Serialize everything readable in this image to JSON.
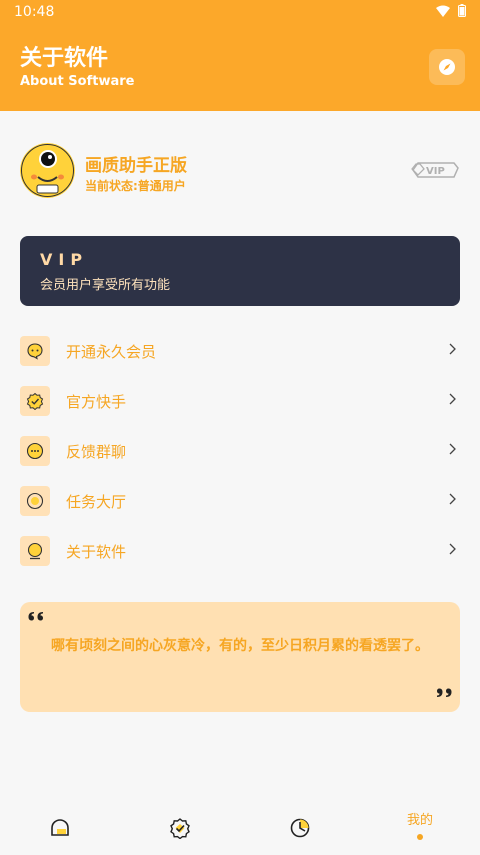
{
  "status_bar": {
    "time": "10:48"
  },
  "header": {
    "title": "关于软件",
    "subtitle": "About Software",
    "compass_icon": "compass-icon"
  },
  "profile": {
    "app_name": "画质助手正版",
    "status": "当前状态:普通用户",
    "badge": "VIP"
  },
  "vip_card": {
    "title": "VIP",
    "description": "会员用户享受所有功能"
  },
  "menu": [
    {
      "label": "开通永久会员",
      "icon": "chat-icon"
    },
    {
      "label": "官方快手",
      "icon": "badge-check-icon"
    },
    {
      "label": "反馈群聊",
      "icon": "message-dots-icon"
    },
    {
      "label": "任务大厅",
      "icon": "circle-icon"
    },
    {
      "label": "关于软件",
      "icon": "info-icon"
    }
  ],
  "quote": {
    "text": "哪有顷刻之间的心灰意冷，有的，至少日积月累的看透罢了。"
  },
  "bottom_nav": {
    "mine_label": "我的"
  },
  "colors": {
    "accent": "#fca82a",
    "text_accent": "#f6a623",
    "vip_card_bg": "#2d3246",
    "quote_bg": "#ffe0b2"
  }
}
